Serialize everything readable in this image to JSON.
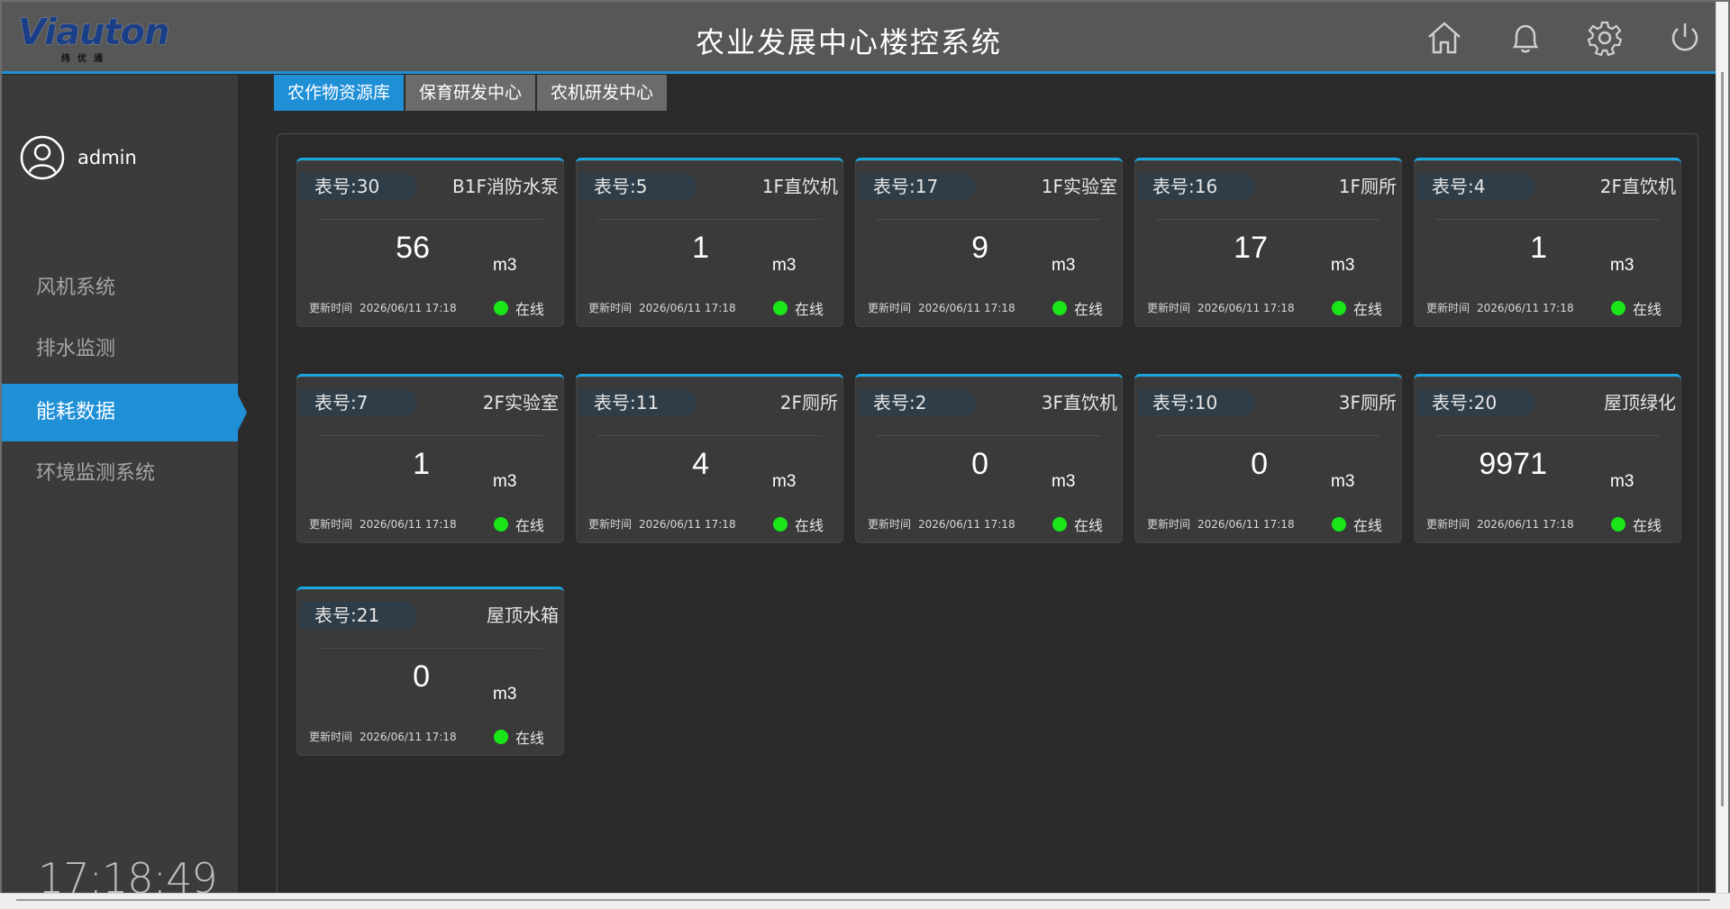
{
  "header": {
    "logo_text": "Viauton",
    "logo_sub": "纬优通",
    "title": "农业发展中心楼控系统",
    "icons": [
      "home-icon",
      "bell-icon",
      "gear-icon",
      "power-icon"
    ]
  },
  "sidebar": {
    "user": {
      "name": "admin",
      "icon": "user-avatar-icon"
    },
    "items": [
      {
        "label": "风机系统"
      },
      {
        "label": "排水监测"
      },
      {
        "label": "能耗数据",
        "active": true
      },
      {
        "label": "环境监测系统"
      }
    ],
    "clock": "17:18:49"
  },
  "tabs": [
    {
      "label": "农作物资源库",
      "active": true
    },
    {
      "label": "保育研发中心"
    },
    {
      "label": "农机研发中心"
    }
  ],
  "colors": {
    "accent": "#1f8fd6",
    "card_border": "#1ca6e0",
    "online": "#19e619",
    "header_bg": "#575757"
  },
  "cards": [
    {
      "meter": "表号:30",
      "location": "B1F消防水泵",
      "value": "56",
      "unit": "m3",
      "update_label": "更新时间",
      "update_time": "2026/06/11 17:18",
      "status": "在线"
    },
    {
      "meter": "表号:5",
      "location": "1F直饮机",
      "value": "1",
      "unit": "m3",
      "update_label": "更新时间",
      "update_time": "2026/06/11 17:18",
      "status": "在线"
    },
    {
      "meter": "表号:17",
      "location": "1F实验室",
      "value": "9",
      "unit": "m3",
      "update_label": "更新时间",
      "update_time": "2026/06/11 17:18",
      "status": "在线"
    },
    {
      "meter": "表号:16",
      "location": "1F厕所",
      "value": "17",
      "unit": "m3",
      "update_label": "更新时间",
      "update_time": "2026/06/11 17:18",
      "status": "在线"
    },
    {
      "meter": "表号:4",
      "location": "2F直饮机",
      "value": "1",
      "unit": "m3",
      "update_label": "更新时间",
      "update_time": "2026/06/11 17:18",
      "status": "在线"
    },
    {
      "meter": "表号:7",
      "location": "2F实验室",
      "value": "1",
      "unit": "m3",
      "update_label": "更新时间",
      "update_time": "2026/06/11 17:18",
      "status": "在线"
    },
    {
      "meter": "表号:11",
      "location": "2F厕所",
      "value": "4",
      "unit": "m3",
      "update_label": "更新时间",
      "update_time": "2026/06/11 17:18",
      "status": "在线"
    },
    {
      "meter": "表号:2",
      "location": "3F直饮机",
      "value": "0",
      "unit": "m3",
      "update_label": "更新时间",
      "update_time": "2026/06/11 17:18",
      "status": "在线"
    },
    {
      "meter": "表号:10",
      "location": "3F厕所",
      "value": "0",
      "unit": "m3",
      "update_label": "更新时间",
      "update_time": "2026/06/11 17:18",
      "status": "在线"
    },
    {
      "meter": "表号:20",
      "location": "屋顶绿化",
      "value": "9971",
      "unit": "m3",
      "update_label": "更新时间",
      "update_time": "2026/06/11 17:18",
      "status": "在线"
    },
    {
      "meter": "表号:21",
      "location": "屋顶水箱",
      "value": "0",
      "unit": "m3",
      "update_label": "更新时间",
      "update_time": "2026/06/11 17:18",
      "status": "在线"
    }
  ]
}
